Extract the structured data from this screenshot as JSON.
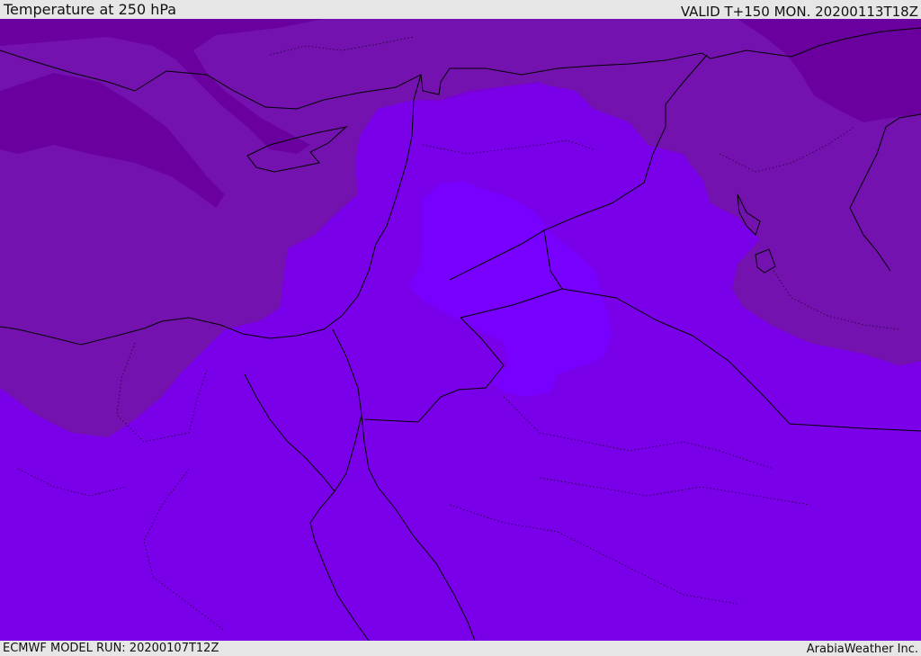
{
  "header": {
    "title": "Temperature at 250 hPa",
    "valid": "VALID T+150 MON. 20200113T18Z"
  },
  "footer": {
    "model_run": "ECMWF MODEL RUN: 20200107T12Z",
    "credit": "ArabiaWeather Inc."
  },
  "colors": {
    "background_band": "#7a00d8",
    "warm_core": "#7700ff",
    "mid_band": "#7a00ea",
    "cool_band": "#7412b0",
    "coldest_band": "#6a009e",
    "coastline": "#000000"
  }
}
